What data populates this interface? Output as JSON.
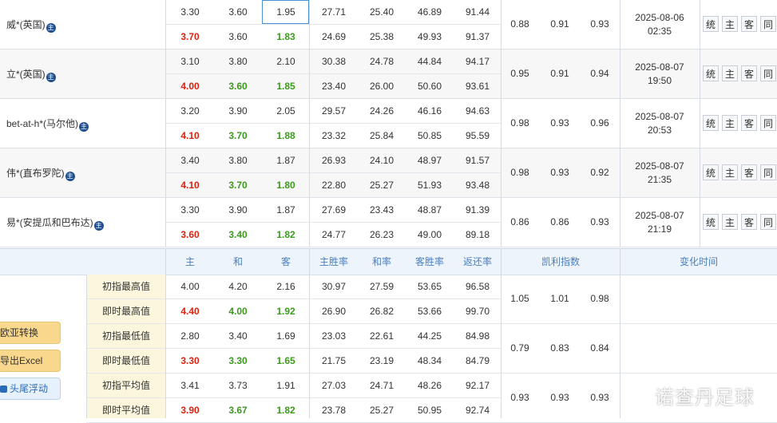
{
  "companies": [
    {
      "name": "威*(英国)",
      "badge": "主",
      "init": [
        "3.30",
        "3.60",
        "1.95",
        "27.71",
        "25.40",
        "46.89",
        "91.44"
      ],
      "live": [
        "3.70",
        "3.60",
        "1.83",
        "24.69",
        "25.38",
        "49.93",
        "91.37"
      ],
      "kelly": [
        "0.88",
        "0.91",
        "0.93"
      ],
      "date": "2025-08-06",
      "time": "02:35"
    },
    {
      "name": "立*(英国)",
      "badge": "主",
      "init": [
        "3.10",
        "3.80",
        "2.10",
        "30.38",
        "24.78",
        "44.84",
        "94.17"
      ],
      "live": [
        "4.00",
        "3.60",
        "1.85",
        "23.40",
        "26.00",
        "50.60",
        "93.61"
      ],
      "kelly": [
        "0.95",
        "0.91",
        "0.94"
      ],
      "date": "2025-08-07",
      "time": "19:50"
    },
    {
      "name": "bet-at-h*(马尔他)",
      "badge": "主",
      "init": [
        "3.20",
        "3.90",
        "2.05",
        "29.57",
        "24.26",
        "46.16",
        "94.63"
      ],
      "live": [
        "4.10",
        "3.70",
        "1.88",
        "23.32",
        "25.84",
        "50.85",
        "95.59"
      ],
      "kelly": [
        "0.98",
        "0.93",
        "0.96"
      ],
      "date": "2025-08-07",
      "time": "20:53"
    },
    {
      "name": "伟*(直布罗陀)",
      "badge": "主",
      "init": [
        "3.40",
        "3.80",
        "1.87",
        "26.93",
        "24.10",
        "48.97",
        "91.57"
      ],
      "live": [
        "4.10",
        "3.70",
        "1.80",
        "22.80",
        "25.27",
        "51.93",
        "93.48"
      ],
      "kelly": [
        "0.98",
        "0.93",
        "0.92"
      ],
      "date": "2025-08-07",
      "time": "21:35"
    },
    {
      "name": "易*(安提瓜和巴布达)",
      "badge": "主",
      "init": [
        "3.30",
        "3.90",
        "1.87",
        "27.69",
        "23.43",
        "48.87",
        "91.39"
      ],
      "live": [
        "3.60",
        "3.40",
        "1.82",
        "24.77",
        "26.23",
        "49.00",
        "89.18"
      ],
      "kelly": [
        "0.86",
        "0.86",
        "0.93"
      ],
      "date": "2025-08-07",
      "time": "21:19"
    }
  ],
  "action_buttons": [
    "统",
    "主",
    "客",
    "同"
  ],
  "summary_header": [
    "主",
    "和",
    "客",
    "主胜率",
    "和率",
    "客胜率",
    "返还率",
    "凯利指数",
    "变化时间"
  ],
  "summary_rows": [
    {
      "label": "初指最高值",
      "values": [
        "4.00",
        "4.20",
        "2.16",
        "30.97",
        "27.59",
        "53.65",
        "96.58"
      ]
    },
    {
      "label": "即时最高值",
      "values": [
        "4.40",
        "4.00",
        "1.92",
        "26.90",
        "26.82",
        "53.66",
        "99.70"
      ]
    },
    {
      "label": "初指最低值",
      "values": [
        "2.80",
        "3.40",
        "1.69",
        "23.03",
        "22.61",
        "44.25",
        "84.98"
      ]
    },
    {
      "label": "即时最低值",
      "values": [
        "3.30",
        "3.30",
        "1.65",
        "21.75",
        "23.19",
        "48.34",
        "84.79"
      ]
    },
    {
      "label": "初指平均值",
      "values": [
        "3.41",
        "3.73",
        "1.91",
        "27.03",
        "24.71",
        "48.26",
        "92.17"
      ]
    },
    {
      "label": "即时平均值",
      "values": [
        "3.90",
        "3.67",
        "1.82",
        "23.78",
        "25.27",
        "50.95",
        "92.74"
      ]
    }
  ],
  "summary_kelly": [
    [
      "1.05",
      "1.01",
      "0.98"
    ],
    [
      "0.79",
      "0.83",
      "0.84"
    ],
    [
      "0.93",
      "0.93",
      "0.93"
    ]
  ],
  "side_buttons": [
    "欧亚转换",
    "导出Excel",
    "头尾浮动"
  ],
  "watermark": "诺查丹足球",
  "colors": {
    "up": "#e0200c",
    "down": "#3a9a1b",
    "header": "#4a7fc0",
    "float_btn": "#f9d78d"
  }
}
